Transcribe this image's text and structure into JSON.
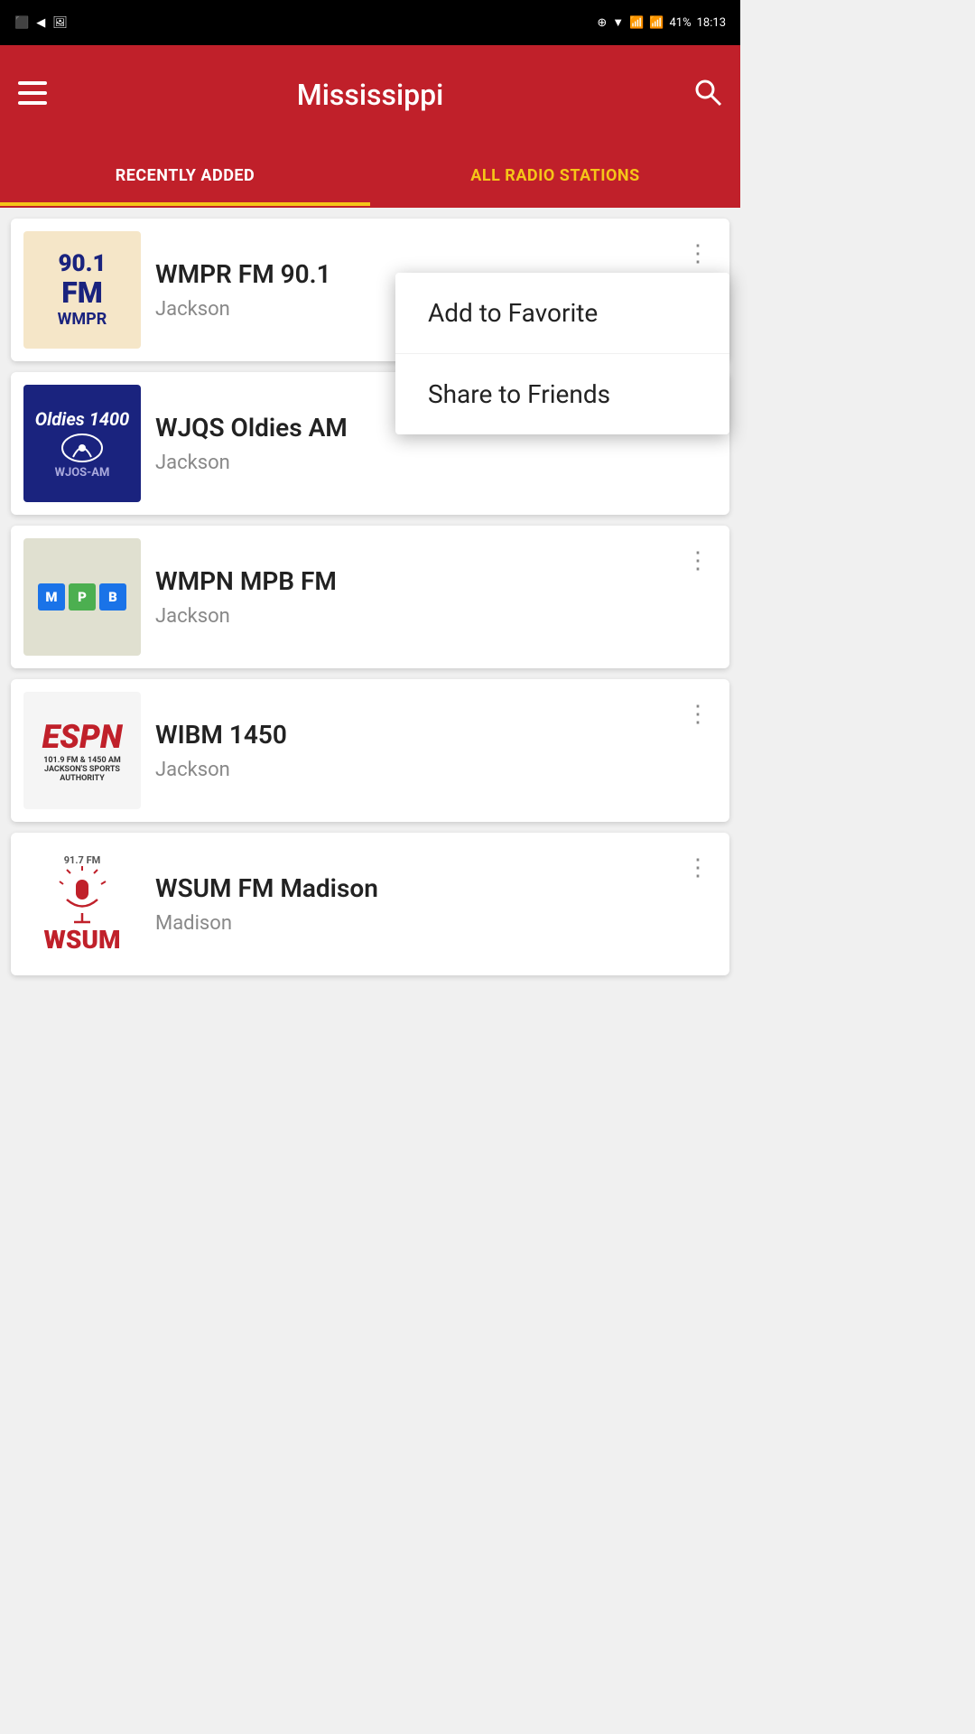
{
  "statusBar": {
    "time": "18:13",
    "battery": "41%",
    "icons": [
      "notification",
      "back",
      "image",
      "circle-plus",
      "wifi",
      "signal1",
      "signal2"
    ]
  },
  "appBar": {
    "title": "Mississippi",
    "menuLabel": "Menu",
    "searchLabel": "Search"
  },
  "tabs": [
    {
      "id": "recently-added",
      "label": "RECENTLY ADDED",
      "active": false
    },
    {
      "id": "all-radio-stations",
      "label": "ALL RADIO STATIONS",
      "active": true
    }
  ],
  "stations": [
    {
      "id": "wmpr",
      "name": "WMPR FM 90.1",
      "city": "Jackson",
      "logoType": "wmpr",
      "hasDropdown": true,
      "dropdownOpen": true
    },
    {
      "id": "wjqs",
      "name": "WJQS Oldies AM",
      "city": "Jackson",
      "logoType": "oldies",
      "hasDropdown": false
    },
    {
      "id": "wmpn",
      "name": "WMPN MPB FM",
      "city": "Jackson",
      "logoType": "mpb",
      "hasDropdown": false
    },
    {
      "id": "wibm",
      "name": "WIBM 1450",
      "city": "Jackson",
      "logoType": "espn",
      "hasDropdown": false
    },
    {
      "id": "wsum",
      "name": "WSUM FM Madison",
      "city": "Madison",
      "logoType": "wsum",
      "hasDropdown": false
    }
  ],
  "contextMenu": {
    "items": [
      {
        "id": "add-favorite",
        "label": "Add to Favorite"
      },
      {
        "id": "share-friends",
        "label": "Share to Friends"
      }
    ]
  }
}
